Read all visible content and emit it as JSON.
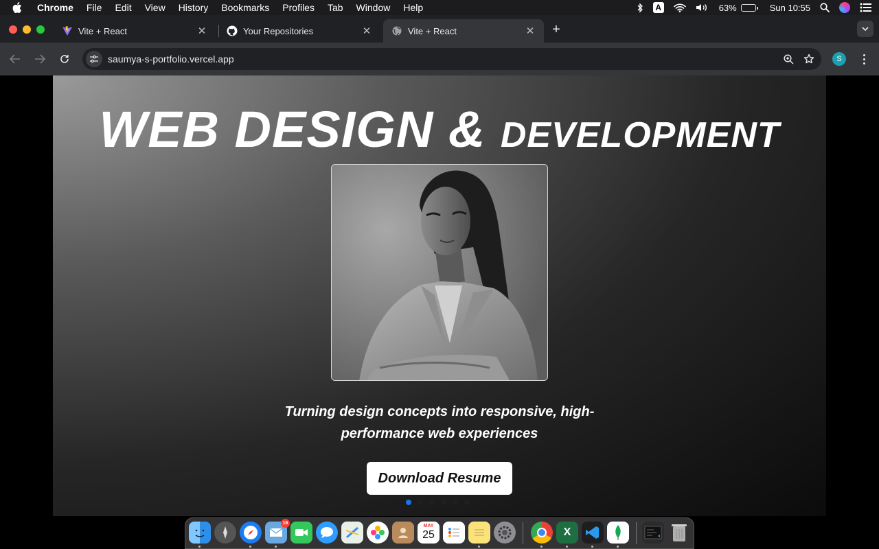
{
  "menubar": {
    "app_name": "Chrome",
    "items": [
      "File",
      "Edit",
      "View",
      "History",
      "Bookmarks",
      "Profiles",
      "Tab",
      "Window",
      "Help"
    ],
    "input_source": "A",
    "battery_percent": "63%",
    "battery_level": 0.63,
    "clock": "Sun 10:55"
  },
  "tabs": [
    {
      "title": "Vite + React",
      "favicon": "vite-icon",
      "active": false
    },
    {
      "title": "Your Repositories",
      "favicon": "github-icon",
      "active": false
    },
    {
      "title": "Vite + React",
      "favicon": "globe-icon",
      "active": true
    }
  ],
  "toolbar": {
    "url": "saumya-s-portfolio.vercel.app",
    "profile_initial": "S"
  },
  "hero": {
    "title_big": "WEB DESIGN & ",
    "title_small": "DEVELOPMENT",
    "portrait_alt": "portrait-photo",
    "tagline": "Turning design concepts into responsive, high-performance web experiences",
    "button_label": "Download Resume",
    "carousel_count": 6,
    "carousel_active": 0
  },
  "dock": {
    "apps": [
      "finder-icon",
      "launchpad-icon",
      "safari-icon",
      "mail-icon",
      "facetime-icon",
      "messages-icon",
      "maps-icon",
      "photos-icon",
      "contacts-icon",
      "calendar-icon",
      "reminders-icon",
      "notes-icon",
      "system-settings-icon",
      "chrome-icon",
      "excel-icon",
      "vscode-icon",
      "mongodb-compass-icon",
      "terminal-vscode-icon",
      "trash-icon"
    ],
    "calendar_month": "MAY",
    "calendar_day": "25",
    "mail_badge": "16",
    "excel_letter": "X"
  }
}
